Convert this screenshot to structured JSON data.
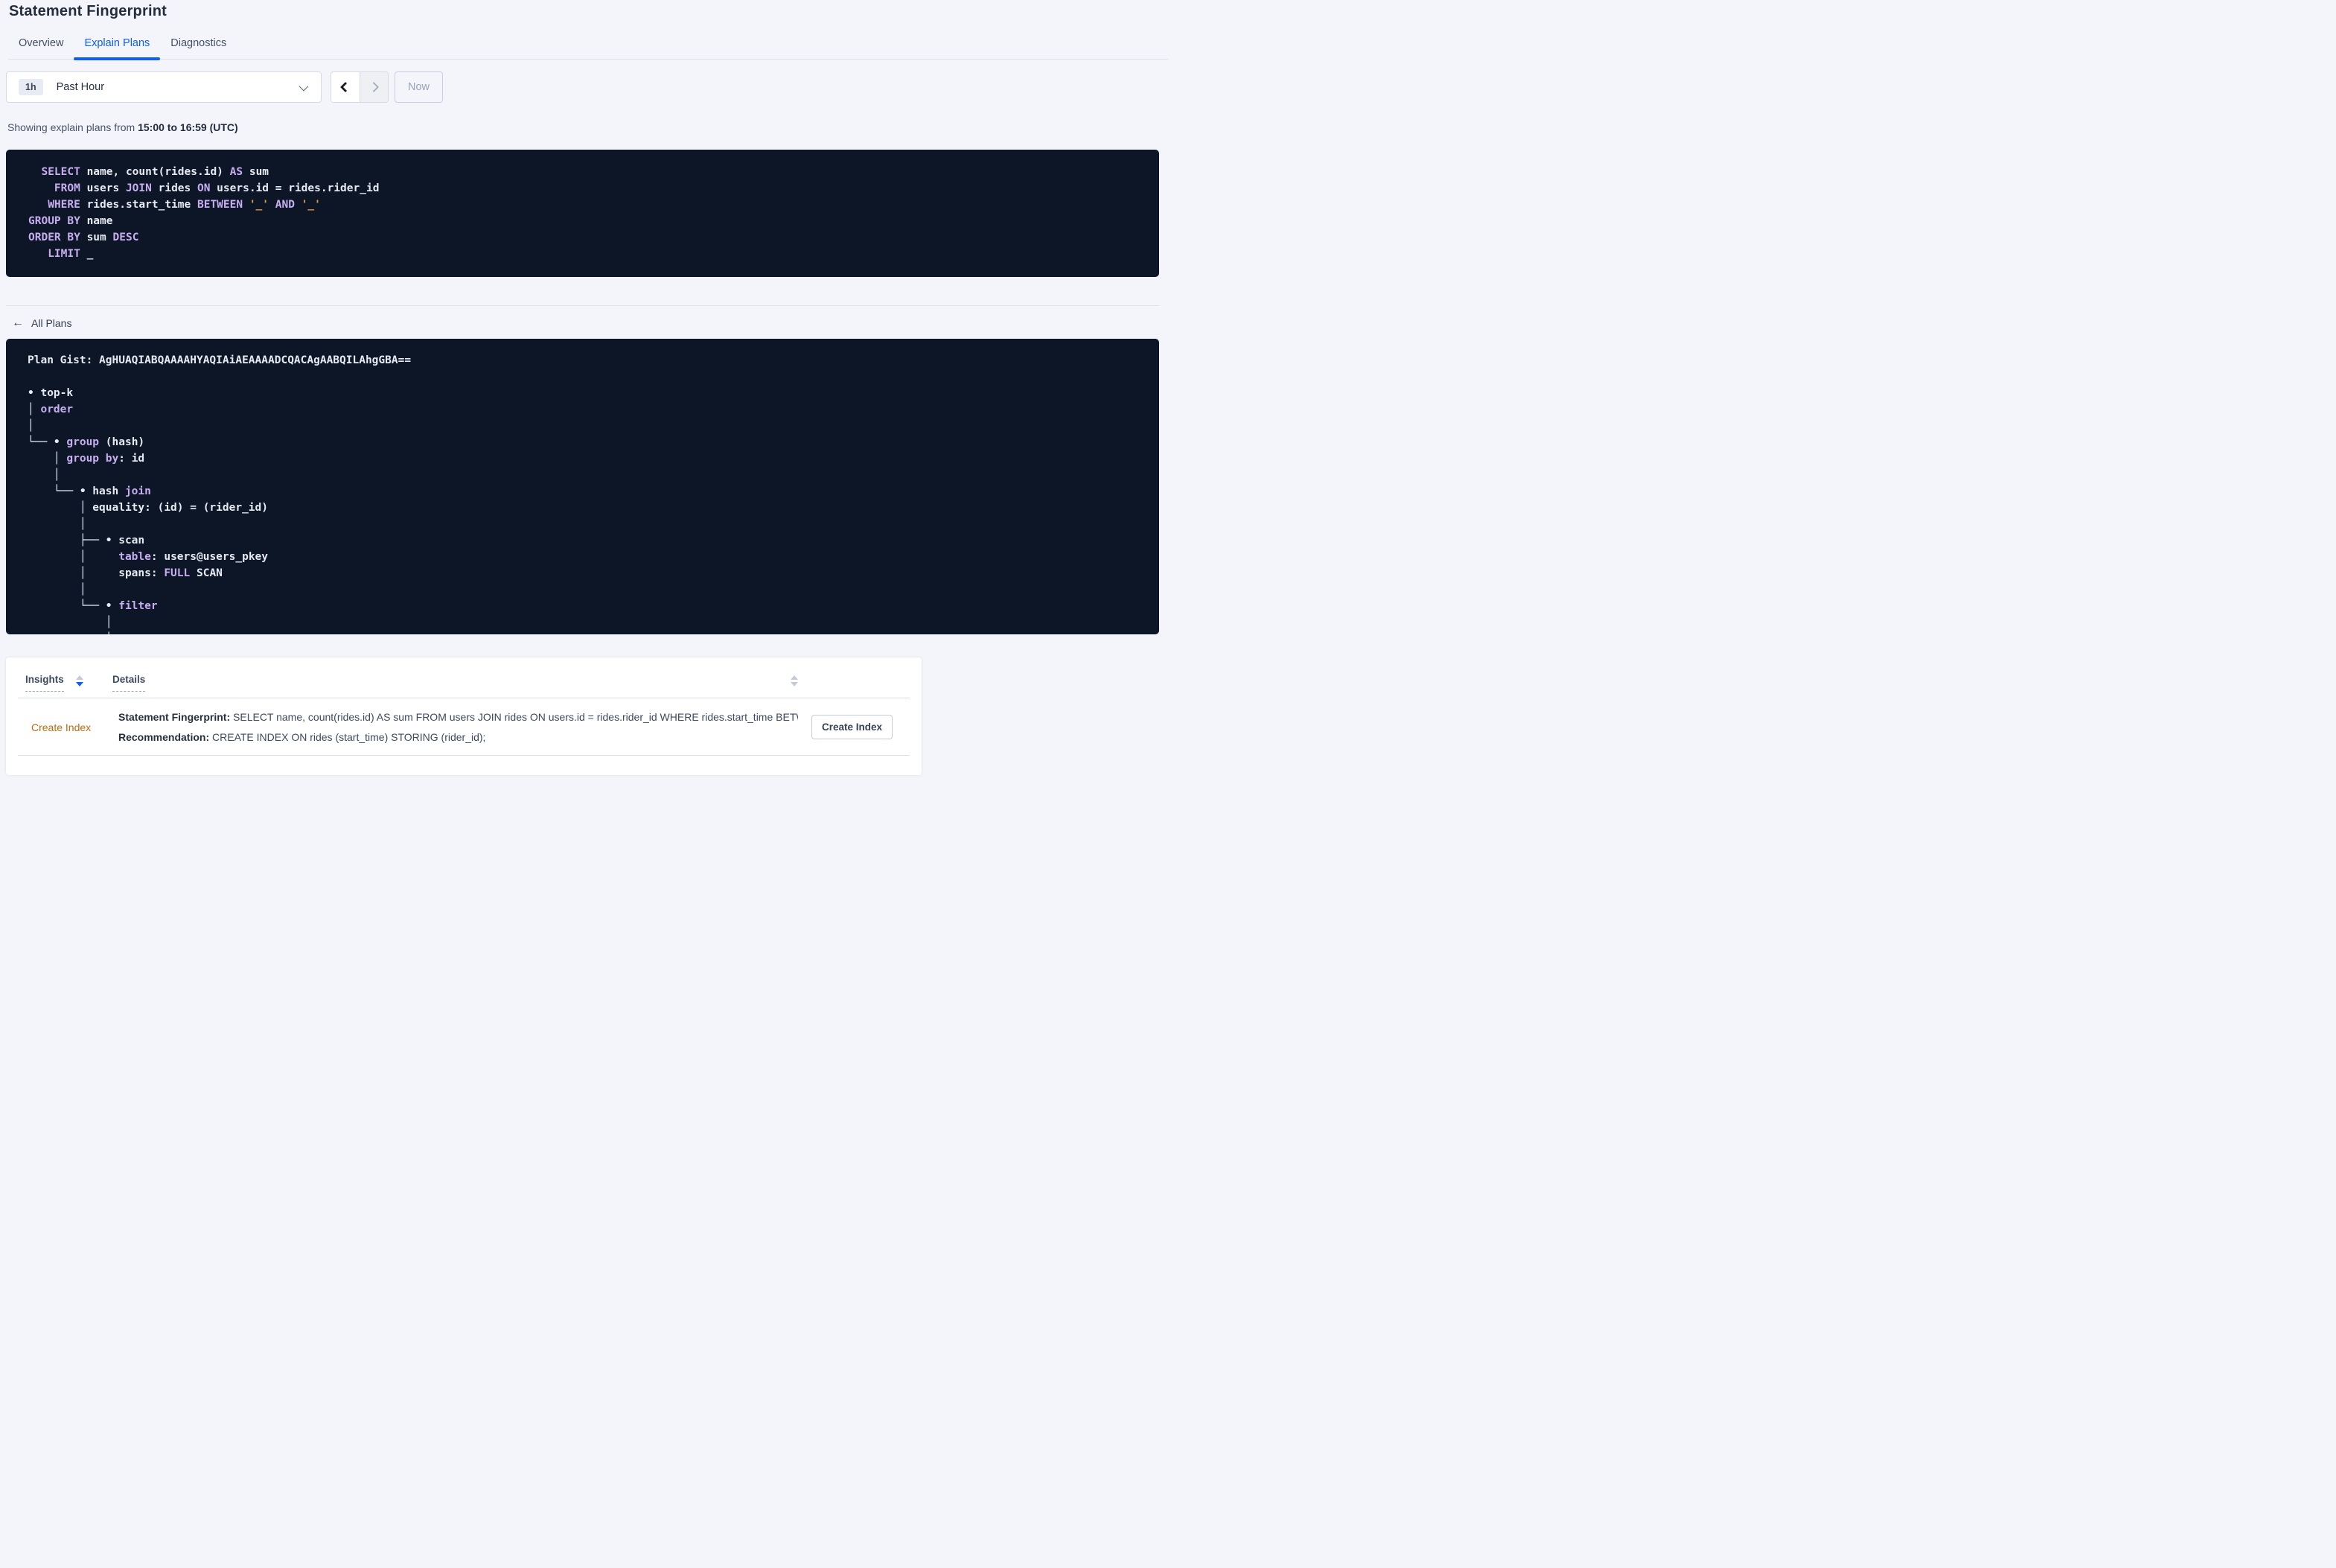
{
  "page": {
    "title": "Statement Fingerprint"
  },
  "tabs": [
    {
      "label": "Overview"
    },
    {
      "label": "Explain Plans"
    },
    {
      "label": "Diagnostics"
    }
  ],
  "time_picker": {
    "badge": "1h",
    "label": "Past Hour",
    "now_label": "Now"
  },
  "showing": {
    "prefix": "Showing explain plans from ",
    "range": "15:00 to 16:59 (UTC)"
  },
  "sql_block": {
    "lines": [
      [
        [
          "kw",
          "  SELECT"
        ],
        [
          "id",
          " name, count(rides.id) "
        ],
        [
          "kw",
          "AS"
        ],
        [
          "id",
          " sum"
        ]
      ],
      [
        [
          "kw",
          "    FROM"
        ],
        [
          "id",
          " users "
        ],
        [
          "kw",
          "JOIN"
        ],
        [
          "id",
          " rides "
        ],
        [
          "kw",
          "ON"
        ],
        [
          "id",
          " users.id = rides.rider_id"
        ]
      ],
      [
        [
          "kw",
          "   WHERE"
        ],
        [
          "id",
          " rides.start_time "
        ],
        [
          "kw",
          "BETWEEN"
        ],
        [
          "id",
          " "
        ],
        [
          "str",
          "'_'"
        ],
        [
          "id",
          " "
        ],
        [
          "kw",
          "AND"
        ],
        [
          "id",
          " "
        ],
        [
          "str",
          "'_'"
        ]
      ],
      [
        [
          "kw",
          "GROUP BY"
        ],
        [
          "id",
          " name"
        ]
      ],
      [
        [
          "kw",
          "ORDER BY"
        ],
        [
          "id",
          " sum "
        ],
        [
          "kw",
          "DESC"
        ]
      ],
      [
        [
          "kw",
          "   LIMIT"
        ],
        [
          "id",
          " _"
        ]
      ]
    ]
  },
  "all_plans": {
    "label": "All Plans"
  },
  "icons": {
    "back_arrow": "←"
  },
  "plan_block": {
    "gist_text": "Plan Gist: AgHUAQIABQAAAAHYAQIAiAEAAAADCQACAgAABQILAhgGBA==",
    "tree_lines": [
      [],
      [
        [
          "id",
          "• top-k"
        ]
      ],
      [
        [
          "id",
          "│ "
        ],
        [
          "kw",
          "order"
        ]
      ],
      [
        [
          "id",
          "│"
        ]
      ],
      [
        [
          "id",
          "└── • "
        ],
        [
          "kw",
          "group"
        ],
        [
          "id",
          " (hash)"
        ]
      ],
      [
        [
          "id",
          "    │ "
        ],
        [
          "kw",
          "group by"
        ],
        [
          "id",
          ": id"
        ]
      ],
      [
        [
          "id",
          "    │"
        ]
      ],
      [
        [
          "id",
          "    └── • hash "
        ],
        [
          "kw",
          "join"
        ]
      ],
      [
        [
          "id",
          "        │ equality: (id) = (rider_id)"
        ]
      ],
      [
        [
          "id",
          "        │"
        ]
      ],
      [
        [
          "id",
          "        ├── • scan"
        ]
      ],
      [
        [
          "id",
          "        │     "
        ],
        [
          "kw",
          "table"
        ],
        [
          "id",
          ": users@users_pkey"
        ]
      ],
      [
        [
          "id",
          "        │     spans: "
        ],
        [
          "kw",
          "FULL"
        ],
        [
          "id",
          " SCAN"
        ]
      ],
      [
        [
          "id",
          "        │"
        ]
      ],
      [
        [
          "id",
          "        └── • "
        ],
        [
          "kw",
          "filter"
        ]
      ],
      [
        [
          "id",
          "            │"
        ]
      ],
      [
        [
          "id",
          "            │"
        ]
      ]
    ]
  },
  "insights_table": {
    "columns": [
      {
        "label": "Insights"
      },
      {
        "label": "Details"
      }
    ],
    "rows": [
      {
        "insight": "Create Index",
        "fingerprint_label": "Statement Fingerprint:",
        "fingerprint": " SELECT name, count(rides.id) AS sum FROM users JOIN rides ON users.id = rides.rider_id WHERE rides.start_time BETWEEN '_…",
        "recommendation_label": "Recommendation:",
        "recommendation": " CREATE INDEX ON rides (start_time) STORING (rider_id);",
        "action_label": "Create Index"
      }
    ]
  },
  "colors": {
    "accent_blue": "#0d5ef5",
    "insight_orange": "#bd6a10",
    "code_background": "#0d1626",
    "code_keyword": "#c6aef0",
    "code_text": "#e6eaf3",
    "code_string": "#ea9a3e"
  }
}
